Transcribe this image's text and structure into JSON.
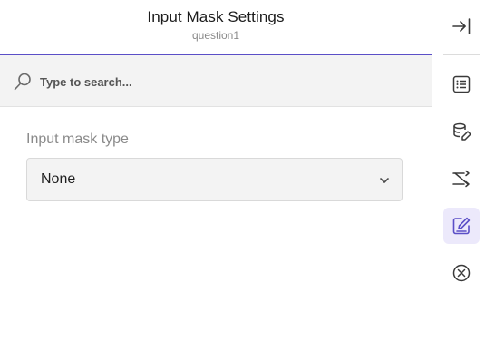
{
  "header": {
    "title": "Input Mask Settings",
    "subtitle": "question1"
  },
  "search": {
    "placeholder": "Type to search...",
    "icon": "search-icon"
  },
  "field": {
    "label": "Input mask type",
    "selected_value": "None"
  },
  "toolbar": {
    "buttons": [
      {
        "name": "collapse-panel-button",
        "icon": "arrow-to-right-icon"
      },
      {
        "name": "general-settings-button",
        "icon": "list-icon"
      },
      {
        "name": "data-settings-button",
        "icon": "database-icon"
      },
      {
        "name": "logic-settings-button",
        "icon": "route-icon"
      },
      {
        "name": "input-mask-settings-button",
        "icon": "edit-icon",
        "active": true
      },
      {
        "name": "validation-settings-button",
        "icon": "circle-x-icon"
      }
    ]
  },
  "colors": {
    "accent": "#5b4fc7",
    "active_bg": "#ece9fb",
    "icon": "#3a3a3a",
    "active_icon": "#5b4fc7"
  }
}
